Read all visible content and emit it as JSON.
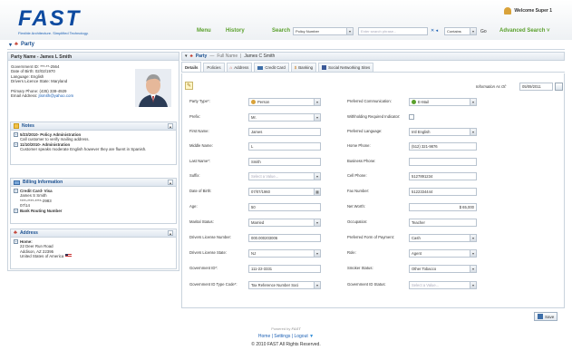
{
  "header": {
    "logo_word": "FAST",
    "logo_tag": "Flexible Architecture. Simplified Technology.",
    "menu": "Menu",
    "history": "History",
    "search_label": "Search",
    "search_type": "Policy Number",
    "search_placeholder": "Enter search phrase...",
    "match": "Contains",
    "go": "Go",
    "advanced": "Advanced Search",
    "welcome": "Welcome Super 1"
  },
  "page": {
    "title": "Party"
  },
  "left": {
    "heading": "Party Name - James L Smith",
    "summary": [
      "Government ID: ***-**-2564",
      "Date of Birth: 02/02/1970",
      "Language: English",
      "Drivers Licence State: Maryland",
      "",
      "Primary Phone: (435) 338-4929",
      "Email Address: "
    ],
    "email": "jtsmith@yahoo.com",
    "notes_title": "Notes",
    "notes": [
      {
        "head": "5/23/2010- Policy Administration",
        "body": "Call customer to verify mailing address."
      },
      {
        "head": "11/10/2010- Administration",
        "body": "Customer speaks moderate English however they are fluent in Spanish."
      }
    ],
    "billing_title": "Billing Information",
    "billing": [
      "Credit Card-  Visa",
      "James S Smith",
      "****-****-****-2983",
      "07/14",
      "Bank Routing Number"
    ],
    "address_title": "Address",
    "address": [
      "Home:",
      "22 Deer Run Road",
      "Addison, AZ 22395",
      "United States of America"
    ]
  },
  "right": {
    "crumb_root": "Party",
    "crumb_mid": "Full Name",
    "crumb_end": "James C Smith",
    "tabs": [
      "Details",
      "Policies",
      "Address",
      "Credit Card",
      "Banking",
      "Social Networking Sites"
    ],
    "info_label": "Information As Of:",
    "info_date": "05/09/2011",
    "left_fields": [
      {
        "label": "Party Type*:",
        "value": "Person"
      },
      {
        "label": "Prefix:",
        "value": "Mr."
      },
      {
        "label": "First Name:",
        "value": "James"
      },
      {
        "label": "Middle Name:",
        "value": "L"
      },
      {
        "label": "Last Name*:",
        "value": "Smith"
      },
      {
        "label": "Suffix:",
        "value": "Select a Value..."
      },
      {
        "label": "Date of Birth:",
        "value": "07/07/1960"
      },
      {
        "label": "Age:",
        "value": "50"
      },
      {
        "label": "Marital Status:",
        "value": "Married"
      },
      {
        "label": "Drivers License Number:",
        "value": "000.000203006"
      },
      {
        "label": "Drivers License State:",
        "value": "NJ"
      },
      {
        "label": "Government ID*:",
        "value": "111-22-3331"
      },
      {
        "label": "Government ID Type Code*:",
        "value": "Tax Reference Number Soci"
      }
    ],
    "right_fields": [
      {
        "label": "Preferred Communication:",
        "value": "E-Mail"
      },
      {
        "label": "Withholding Required Indicator:",
        "value": ""
      },
      {
        "label": "Preferred Language:",
        "value": "Intl English"
      },
      {
        "label": "Home Phone:",
        "value": "(512) 321-9876"
      },
      {
        "label": "Business Phone:",
        "value": ""
      },
      {
        "label": "Cell Phone:",
        "value": "5127891234"
      },
      {
        "label": "Fax Number:",
        "value": "5122334444"
      },
      {
        "label": "Net Worth:",
        "value": "$ 65,000"
      },
      {
        "label": "Occupation:",
        "value": "Teacher"
      },
      {
        "label": "Preferred Form of Payment:",
        "value": "Cash"
      },
      {
        "label": "Role:",
        "value": "Agent"
      },
      {
        "label": "Smoker Status:",
        "value": "Other Tobacco"
      },
      {
        "label": "Government ID Status:",
        "value": "Select a Value..."
      }
    ],
    "save": "Save"
  },
  "footer": {
    "powered": "Powered by",
    "links": "Home | Settings | Logout",
    "copyright": "© 2010 FAST  All Rights Reserved."
  }
}
